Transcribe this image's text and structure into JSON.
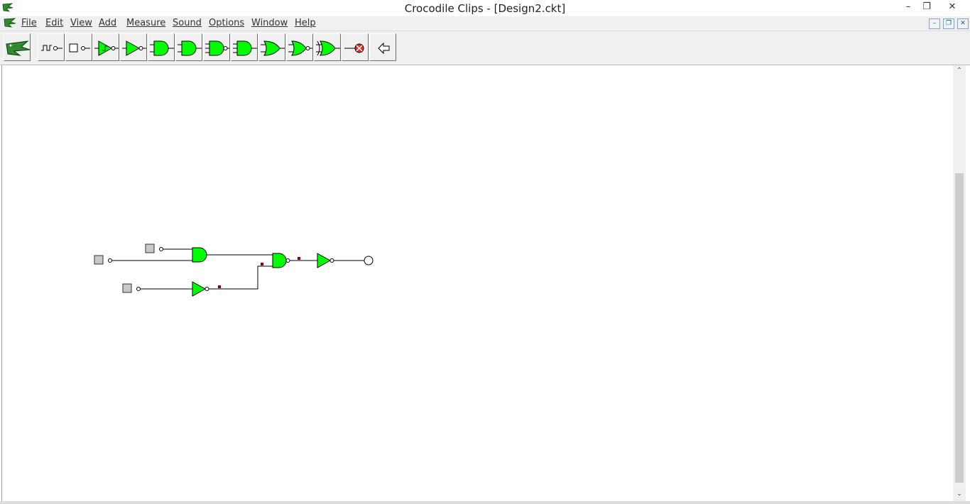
{
  "window": {
    "title": "Crocodile Clips - [Design2.ckt]"
  },
  "menu": {
    "items": [
      {
        "label": "File"
      },
      {
        "label": "Edit"
      },
      {
        "label": "View"
      },
      {
        "label": "Add"
      },
      {
        "label": "Measure"
      },
      {
        "label": "Sound"
      },
      {
        "label": "Options"
      },
      {
        "label": "Window"
      },
      {
        "label": "Help"
      }
    ]
  },
  "toolbar": {
    "buttons": [
      "crocodile-logo",
      "clock-input",
      "switch-input",
      "schmitt-buffer",
      "buffer",
      "and-gate",
      "nand-gate",
      "and3-gate",
      "nand3-gate",
      "or-gate",
      "nor-gate",
      "xor-gate",
      "led-output",
      "back-arrow"
    ]
  },
  "colors": {
    "gate_fill": "#00ff00",
    "node_marker": "#8b0000",
    "wire": "#000000"
  }
}
